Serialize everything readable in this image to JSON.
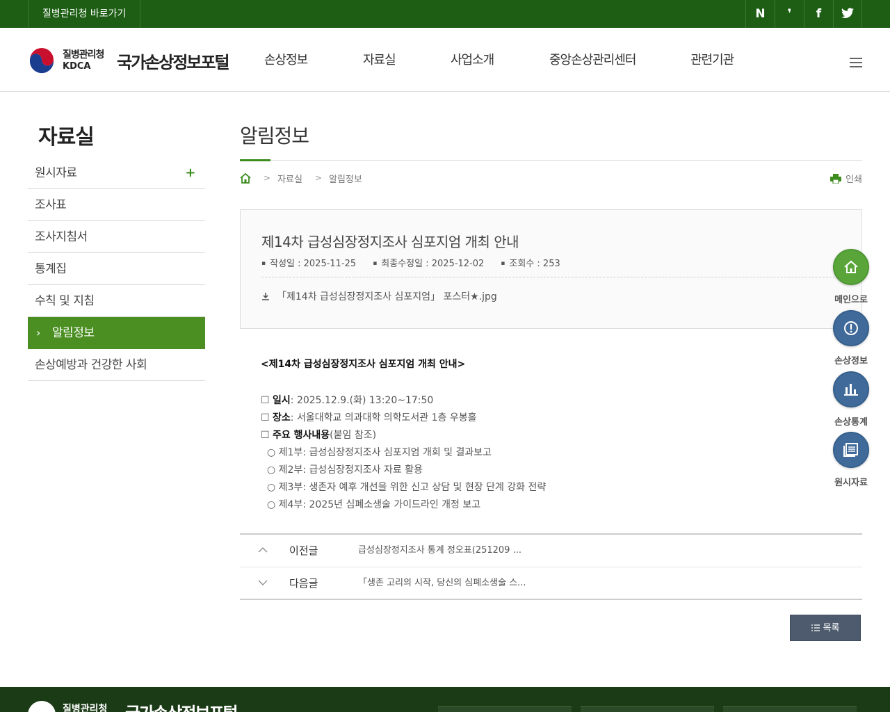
{
  "topbar": {
    "shortcut": "질병관리청 바로가기",
    "social": [
      {
        "icon": "naver-blog-icon",
        "glyph": "N"
      },
      {
        "icon": "kakao-story-icon",
        "glyph": "❜"
      },
      {
        "icon": "facebook-icon",
        "glyph": "f"
      },
      {
        "icon": "twitter-icon",
        "glyph": "🐦"
      }
    ]
  },
  "header": {
    "org_name": "질병관리청",
    "org_abbr": "KDCA",
    "site_name": "국가손상정보포털",
    "nav": [
      "손상정보",
      "자료실",
      "사업소개",
      "중앙손상관리센터",
      "관련기관"
    ]
  },
  "sidebar": {
    "title": "자료실",
    "items": [
      {
        "label": "원시자료",
        "expand": "+"
      },
      {
        "label": "조사표"
      },
      {
        "label": "조사지침서"
      },
      {
        "label": "통계집"
      },
      {
        "label": "수칙 및 지침"
      },
      {
        "label": "알림정보",
        "active": true,
        "chevron": "›"
      },
      {
        "label": "손상예방과 건강한 사회"
      }
    ]
  },
  "page": {
    "title": "알림정보",
    "breadcrumb": [
      "자료실",
      "알림정보"
    ],
    "print_label": "인쇄"
  },
  "article": {
    "title": "제14차 급성심장정지조사 심포지엄 개최 안내",
    "meta": {
      "created": "작성일 : 2025-11-25",
      "modified": "최종수정일 : 2025-12-02",
      "views": "조회수 : 253"
    },
    "attachment": "「제14차 급성심장정지조사 심포지엄」 포스터★.jpg",
    "body": {
      "heading": "<제14차 급성심장정지조사 심포지엄 개최 안내>",
      "date_label": "일시",
      "date_value": ": 2025.12.9.(화) 13:20~17:50",
      "place_label": "장소",
      "place_value": ": 서울대학교 의과대학 의학도서관 1층 우봉홀",
      "program_label": "주요 행사내용",
      "program_note": "(붙임 참조)",
      "box": "☐",
      "circle": "○",
      "sessions": [
        "제1부: 급성심장정지조사 심포지엄 개회 및 결과보고",
        "제2부: 급성심장정지조사 자료 활용",
        "제3부: 생존자 예후 개선을 위한 신고 상담 및 현장 단계 강화 전략",
        "제4부: 2025년 심폐소생술 가이드라인 개정 보고"
      ]
    }
  },
  "prevnext": {
    "prev_label": "이전글",
    "prev_text": "급성심장정지조사 통계 정오표(251209 ...",
    "next_label": "다음글",
    "next_text": "「생존 고리의 시작, 당신의 심폐소생술 스..."
  },
  "list_button": "목록",
  "quick_menu": [
    {
      "label": "메인으로",
      "icon": "home-icon",
      "color": "#5aa53a"
    },
    {
      "label": "손상정보",
      "icon": "alert-icon",
      "color": "#3f6a9a"
    },
    {
      "label": "손상통계",
      "icon": "chart-icon",
      "color": "#3f6a9a"
    },
    {
      "label": "원시자료",
      "icon": "document-icon",
      "color": "#3f6a9a"
    }
  ],
  "footer": {
    "org_name": "질병관리청",
    "site_name": "국가손상정보포털"
  }
}
